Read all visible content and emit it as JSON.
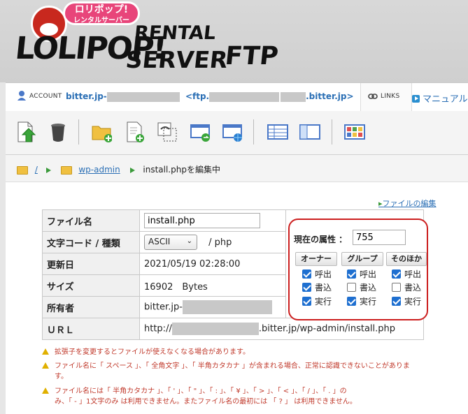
{
  "logo": {
    "bubble_line1": "ロリポップ!",
    "bubble_line2": "レンタルサーバー",
    "main": "LOLIPOP!",
    "rental": "RENTAL",
    "server": "SERVER",
    "ftp": "FTP"
  },
  "account": {
    "label": "ACCOUNT",
    "value_prefix": "bitter.jp-",
    "ftp_prefix": "<ftp.",
    "ftp_suffix": ".bitter.jp>",
    "links_label": "LINKS",
    "manual_label": "マニュアル"
  },
  "breadcrumb": {
    "root": "/",
    "folder": "wp-admin",
    "current": "install.phpを編集中"
  },
  "edit_link": "ファイルの編集",
  "info": {
    "filename_label": "ファイル名",
    "filename_value": "install.php",
    "encoding_label": "文字コード / 種類",
    "encoding_value": "ASCII",
    "type_value": "/ php",
    "updated_label": "更新日",
    "updated_value": "2021/05/19 02:28:00",
    "size_label": "サイズ",
    "size_value": "16902　Bytes",
    "owner_label": "所有者",
    "owner_prefix": "bitter.jp-",
    "url_label": "ＵＲＬ",
    "url_prefix": "http://",
    "url_suffix": ".bitter.jp/wp-admin/install.php"
  },
  "permissions": {
    "label": "現在の属性 ：",
    "value": "755",
    "groups": [
      "オーナー",
      "グループ",
      "そのほか"
    ],
    "read": "呼出",
    "write": "書込",
    "exec": "実行",
    "owner": {
      "read": true,
      "write": true,
      "exec": true
    },
    "group": {
      "read": true,
      "write": false,
      "exec": true
    },
    "other": {
      "read": true,
      "write": false,
      "exec": true
    }
  },
  "warnings": [
    "拡張子を変更するとファイルが使えなくなる場合があります。",
    "ファイル名に「 スペース 」、「 全角文字 」、「 半角カタカナ 」が含まれる場合、正常に認識できないことがありま",
    "す。",
    "ファイル名には「 半角カタカナ 」、「 ' 」、「 \" 」、「 : 」、「 ¥ 」、「 > 」、「 < 」、「 / 」、「 . 」の",
    "み、「 - 」1文字のみ は利用できません。またファイル名の最初には 「 ? 」 は利用できません。"
  ],
  "colors": {
    "accent_blue": "#2b6fb5",
    "warning_red": "#c0392b",
    "highlight_red": "#cc1f1f",
    "checkbox_blue": "#1e6fd0"
  }
}
